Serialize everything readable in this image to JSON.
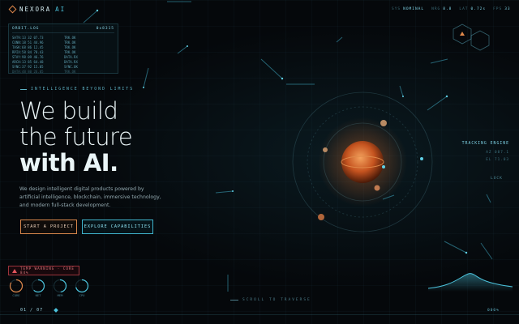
{
  "brand": {
    "name": "NEXORA",
    "suffix": "AI"
  },
  "status": [
    {
      "key": "SYS",
      "value": "NOMINAL"
    },
    {
      "key": "NRG",
      "value": "8.8"
    },
    {
      "key": "LAT",
      "value": "0.72s"
    },
    {
      "key": "FPS",
      "value": "33"
    }
  ],
  "orbit_log": {
    "title": "ORBIT.LOG",
    "code": "0x8315",
    "rows": [
      {
        "time": "SAT9:13 32 07.73",
        "status": "TRK.OK"
      },
      {
        "time": "CONN:18 51 44.96",
        "status": "TRK.OK"
      },
      {
        "time": "TASK:68 86 12.45",
        "status": "TRK.OK"
      },
      {
        "time": "RPIX:58 84 78.43",
        "status": "TRK.OK"
      },
      {
        "time": "STAY:98 09 46.76",
        "status": "DATA.RX"
      },
      {
        "time": "ARCH:13 85 64.48",
        "status": "DATA.RX"
      },
      {
        "time": "SYNC:37 92 15.05",
        "status": "SYNC.OK"
      },
      {
        "time": "DATA:48 80 26.05",
        "status": "TRK.OK"
      }
    ]
  },
  "hero": {
    "tagline": "INTELLIGENCE BEYOND LIMITS",
    "line1": "We build",
    "line2": "the future",
    "line3": "with AI.",
    "description": "We design intelligent digital products powered by artificial intelligence, blockchain, immersive technology, and modern full-stack development."
  },
  "buttons": {
    "start": "START A PROJECT",
    "explore": "EXPLORE CAPABILITIES"
  },
  "warning": "TEMP WARNING · CORE 84%",
  "gauges": [
    {
      "label": "CORE",
      "value": 0.84,
      "color": "#e0884a"
    },
    {
      "label": "NET",
      "value": 0.62,
      "color": "#4cc3dc"
    },
    {
      "label": "MEM",
      "value": 0.48,
      "color": "#4cc3dc"
    },
    {
      "label": "CPU",
      "value": 0.71,
      "color": "#4cc3dc"
    }
  ],
  "pager": {
    "current": "01",
    "total": "07"
  },
  "scroll_hint": "SCROLL TO TRAVERSE",
  "percent": "000%",
  "tracking": {
    "title": "TRACKING ENGINE",
    "line1": "AZ 087.1",
    "line2": "EL 71.03",
    "lock": "LOCK"
  },
  "colors": {
    "accent": "#4cc3dc",
    "orange": "#e0884a",
    "warning": "#e2545c",
    "background": "#05080b"
  }
}
